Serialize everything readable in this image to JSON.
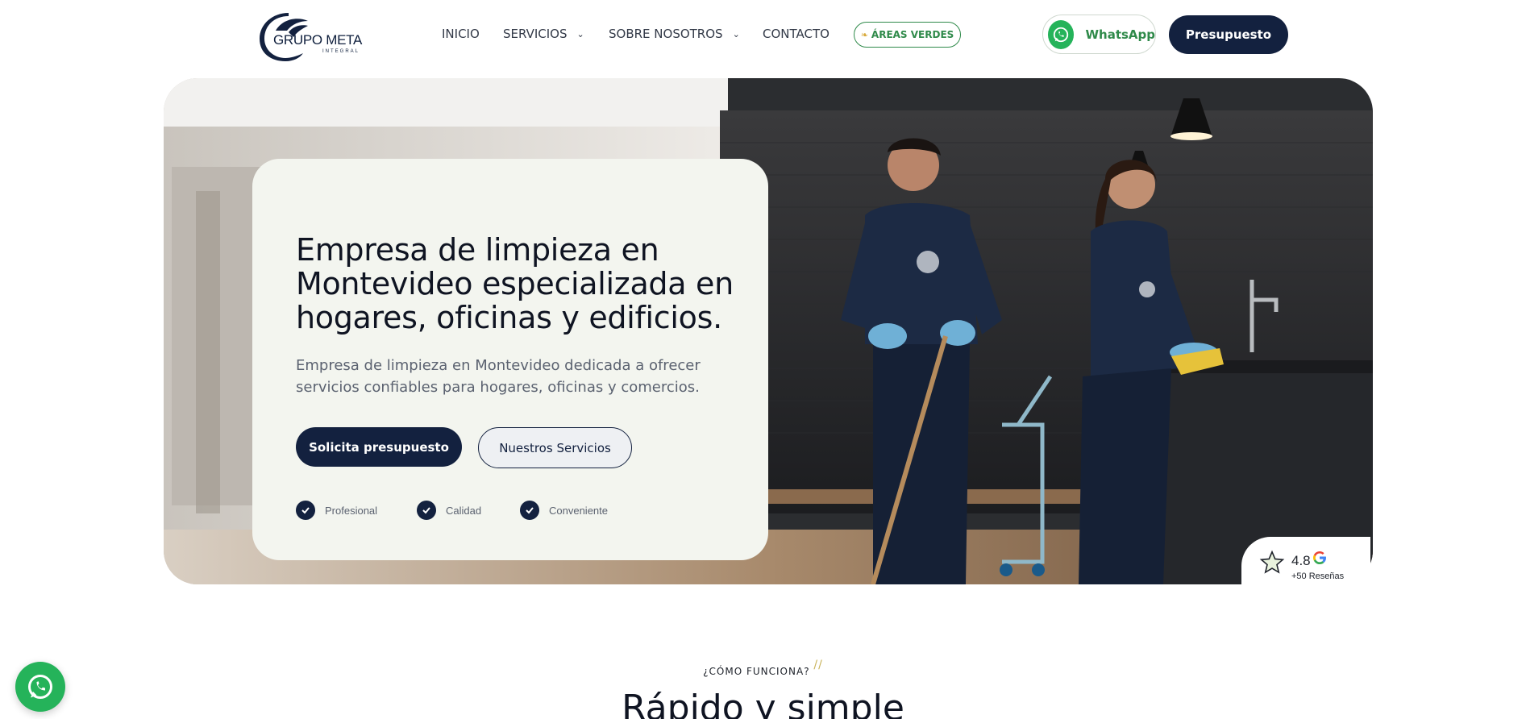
{
  "header": {
    "logo_text": "GRUPO META",
    "logo_subtext": "INTEGRAL",
    "nav": [
      {
        "label": "INICIO",
        "dropdown": false
      },
      {
        "label": "SERVICIOS",
        "dropdown": true
      },
      {
        "label": "SOBRE NOSOTROS",
        "dropdown": true
      },
      {
        "label": "CONTACTO",
        "dropdown": false
      }
    ],
    "areas_label": "ÁREAS VERDES",
    "whatsapp_label": "WhatsApp",
    "quote_label": "Presupuesto"
  },
  "hero": {
    "title": "Empresa de limpieza en Montevideo especializada en hogares, oficinas y edificios.",
    "description": "Empresa de limpieza en Montevideo dedicada a ofrecer servicios confiables para hogares, oficinas y comercios.",
    "primary_button": "Solicita presupuesto",
    "secondary_button": "Nuestros Servicios",
    "features": [
      "Profesional",
      "Calidad",
      "Conveniente"
    ]
  },
  "review": {
    "score": "4.8",
    "count": "+50 Reseñas"
  },
  "section": {
    "eyebrow": "¿CÓMO FUNCIONA?",
    "title": "Rápido y simple"
  },
  "colors": {
    "navy": "#13213f",
    "green": "#2f8a4a",
    "whatsapp": "#25b35a",
    "card_bg": "#f3f5ef"
  }
}
